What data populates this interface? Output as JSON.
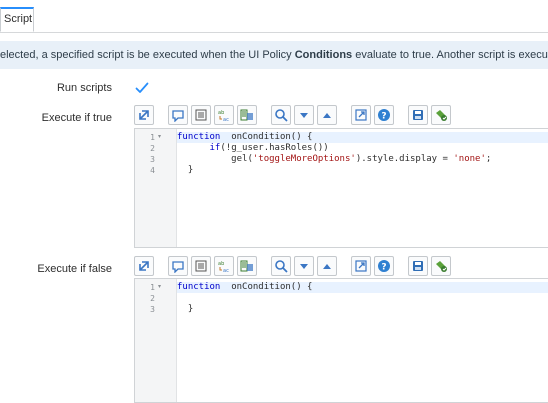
{
  "tab": {
    "label": "Script"
  },
  "info_banner": {
    "before": "elected, a specified script is be executed when the UI Policy ",
    "bold": "Conditions",
    "after": " evaluate to true. Another script is executed when the conditions e"
  },
  "fields": {
    "run_scripts_label": "Run scripts",
    "run_scripts_checked": true,
    "execute_true_label": "Execute if true",
    "execute_false_label": "Execute if false"
  },
  "toolbar_icons": [
    "toggle-syntax-icon",
    "comment-icon",
    "format-icon",
    "replace-icon",
    "replace-all-icon",
    "search-icon",
    "collapse-icon",
    "expand-icon",
    "fullscreen-icon",
    "help-icon",
    "save-icon",
    "script-debug-icon"
  ],
  "editor_true": {
    "lines": [
      {
        "num": "1",
        "fold": "▾",
        "parts": [
          [
            "kw",
            "function"
          ],
          [
            "",
            "  onCondition() {"
          ]
        ]
      },
      {
        "num": "2",
        "fold": "",
        "parts": [
          [
            "",
            "      "
          ],
          [
            "kw",
            "if"
          ],
          [
            "",
            "(!g_user.hasRoles())"
          ]
        ]
      },
      {
        "num": "3",
        "fold": "",
        "parts": [
          [
            "",
            "          gel("
          ],
          [
            "str",
            "'toggleMoreOptions'"
          ],
          [
            "",
            ").style.display = "
          ],
          [
            "str",
            "'none'"
          ],
          [
            "",
            ";"
          ]
        ]
      },
      {
        "num": "4",
        "fold": "",
        "parts": [
          [
            "",
            "  }"
          ]
        ]
      }
    ]
  },
  "editor_false": {
    "lines": [
      {
        "num": "1",
        "fold": "▾",
        "parts": [
          [
            "kw",
            "function"
          ],
          [
            "",
            "  onCondition() {"
          ]
        ]
      },
      {
        "num": "2",
        "fold": "",
        "parts": [
          [
            "",
            ""
          ]
        ]
      },
      {
        "num": "3",
        "fold": "",
        "parts": [
          [
            "",
            "  }"
          ]
        ]
      }
    ]
  },
  "colors": {
    "accent": "#278efc",
    "info_bg": "#e8f0f8",
    "keyword": "#0000cc",
    "string": "#a31515",
    "active_line": "#e8f2ff"
  }
}
